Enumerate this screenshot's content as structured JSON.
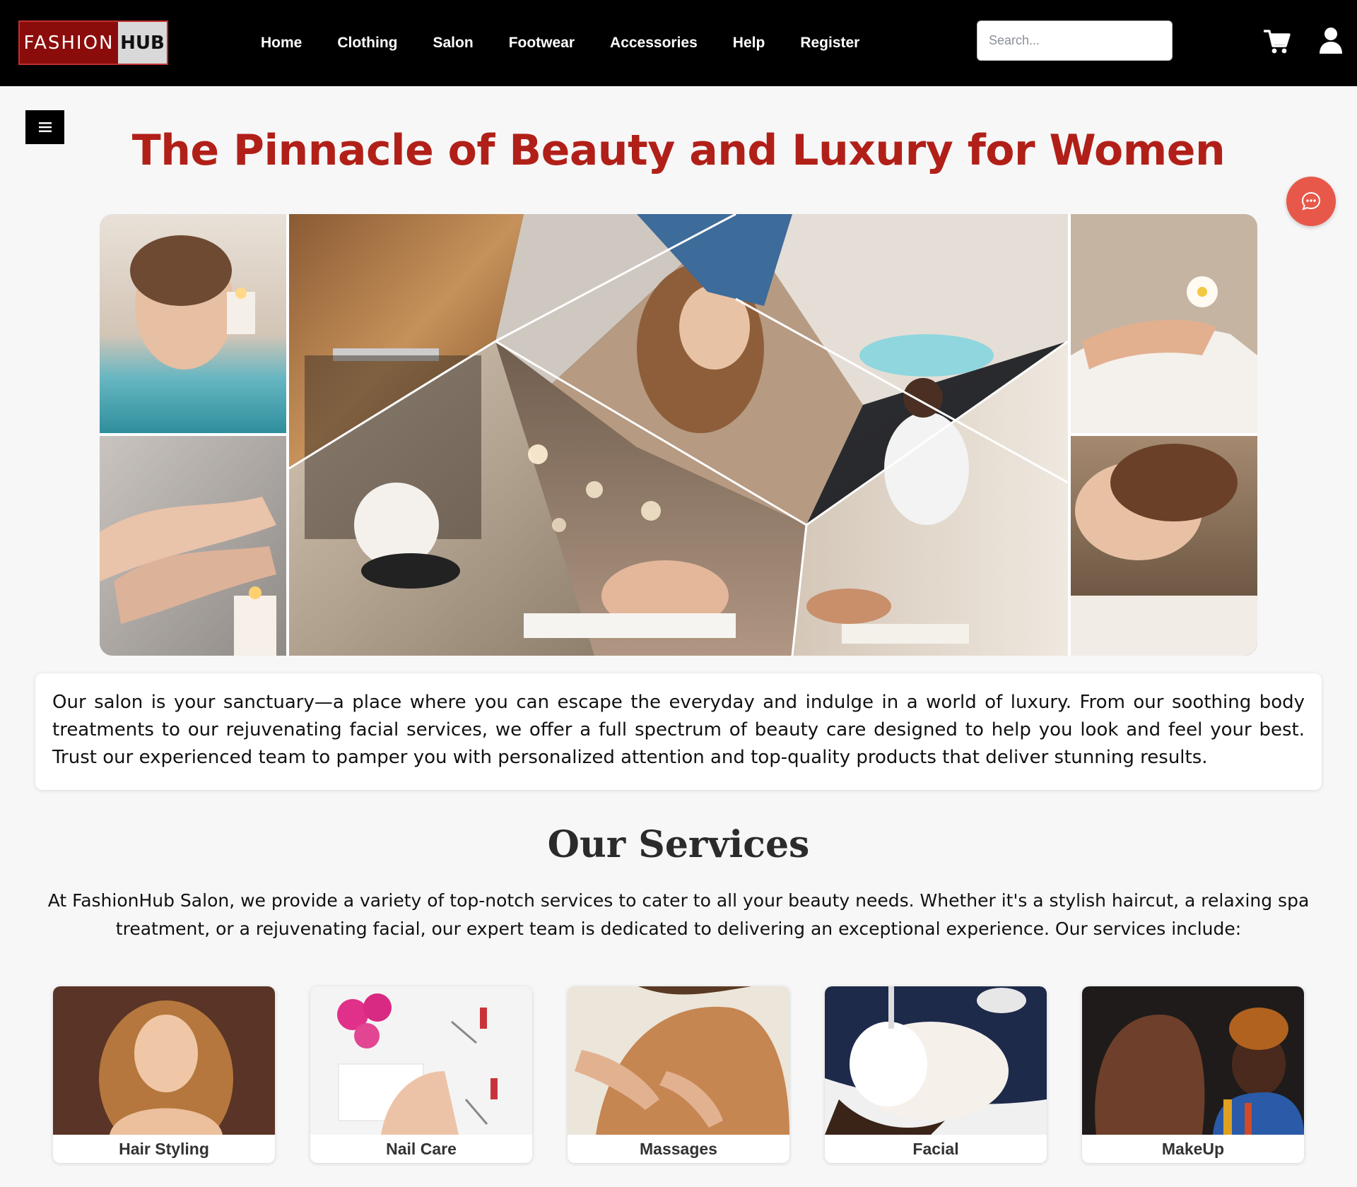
{
  "brand": {
    "left": "FASHION",
    "right": "HUB"
  },
  "nav": {
    "items": [
      {
        "label": "Home"
      },
      {
        "label": "Clothing"
      },
      {
        "label": "Salon"
      },
      {
        "label": "Footwear"
      },
      {
        "label": "Accessories"
      },
      {
        "label": "Help"
      },
      {
        "label": "Register"
      }
    ],
    "search_placeholder": "Search...",
    "icons": [
      "shopping-cart-icon",
      "user-icon"
    ]
  },
  "menu_icon": "hamburger-icon",
  "chat_icon": "chat-bubble-icon",
  "page": {
    "title": "The Pinnacle of Beauty and Luxury for Women",
    "intro": "Our salon is your sanctuary—a place where you can escape the everyday and indulge in a world of luxury. From our soothing body treatments to our rejuvenating facial services, we offer a full spectrum of beauty care designed to help you look and feel your best. Trust our experienced team to pamper you with personalized attention and top-quality products that deliver stunning results."
  },
  "services": {
    "heading": "Our Services",
    "intro": "At FashionHub Salon, we provide a variety of top-notch services to cater to all your beauty needs. Whether it's a stylish haircut, a relaxing spa treatment, or a rejuvenating facial, our expert team is dedicated to delivering an exceptional experience. Our services include:",
    "items": [
      {
        "label": "Hair Styling"
      },
      {
        "label": "Nail Care"
      },
      {
        "label": "Massages"
      },
      {
        "label": "Facial"
      },
      {
        "label": "MakeUp"
      }
    ]
  },
  "colors": {
    "navbar": "#000000",
    "brand_red": "#8b0d0b",
    "title_red": "#b12018",
    "chat_button": "#e8584a",
    "page_bg": "#f7f7f7"
  }
}
